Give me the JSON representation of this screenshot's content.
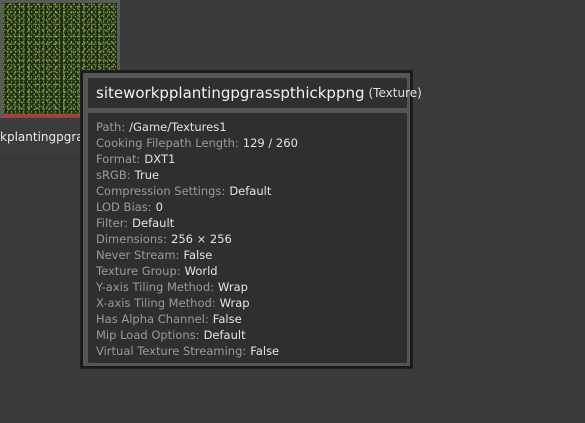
{
  "asset": {
    "name_visible": "kplantingpgra",
    "name_full": "siteworkpplantingpgrasspthickppng"
  },
  "tooltip": {
    "title": "siteworkpplantingpgrasspthickppng",
    "type": "(Texture)",
    "properties": [
      {
        "key": "Path:",
        "value": "/Game/Textures1"
      },
      {
        "key": "Cooking Filepath Length:",
        "value": "129 / 260"
      },
      {
        "key": "Format:",
        "value": "DXT1"
      },
      {
        "key": "sRGB:",
        "value": "True"
      },
      {
        "key": "Compression Settings:",
        "value": "Default"
      },
      {
        "key": "LOD Bias:",
        "value": "0"
      },
      {
        "key": "Filter:",
        "value": "Default"
      },
      {
        "key": "Dimensions:",
        "value": "256 × 256"
      },
      {
        "key": "Never Stream:",
        "value": "False"
      },
      {
        "key": "Texture Group:",
        "value": "World"
      },
      {
        "key": "Y-axis Tiling Method:",
        "value": "Wrap"
      },
      {
        "key": "X-axis Tiling Method:",
        "value": "Wrap"
      },
      {
        "key": "Has Alpha Channel:",
        "value": "False"
      },
      {
        "key": "Mip Load Options:",
        "value": "Default"
      },
      {
        "key": "Virtual Texture Streaming:",
        "value": "False"
      }
    ]
  },
  "colors": {
    "background": "#3a3a3a",
    "asset_type_texture": "#b33a3a",
    "panel": "#2f2f2f"
  }
}
